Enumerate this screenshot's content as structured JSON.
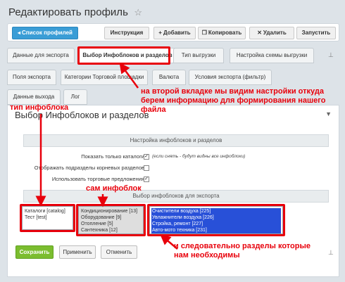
{
  "page_title": "Редактировать профиль",
  "toolbar": {
    "profile_list": "Список профилей",
    "instruction": "Инструкция",
    "add": "Добавить",
    "copy": "Копировать",
    "delete": "Удалить",
    "run": "Запустить"
  },
  "tabs_row1": [
    "Данные для экспорта",
    "Выбор Инфоблоков и разделов",
    "Тип выгрузки",
    "Настройка схемы выгрузки"
  ],
  "tabs_row2": [
    "Поля экспорта",
    "Категории Торговой площадки",
    "Валюта",
    "Условия экспорта (фильтр)"
  ],
  "tabs_row3": [
    "Данные выхода",
    "Лог"
  ],
  "panel": {
    "title": "Выбор Инфоблоков и разделов",
    "section1_title": "Настройка инфоблоков и разделов",
    "opt_show_catalogs": "Показать только каталоги",
    "opt_show_catalogs_note": "(если снять - будут видны все инфоблоки)",
    "opt_show_subsections": "Отображать подразделы корневых разделов",
    "opt_use_offers": "Использовать торговые предложения",
    "section2_title": "Выбор инфоблоков для экспорта"
  },
  "iblock_types": [
    "Каталоги [catalog]",
    "Тест [test]"
  ],
  "iblocks": [
    "Кондиционирование [13]",
    "Оборудование [9]",
    "Отопление [5]",
    "Сантехника [12]"
  ],
  "sections": [
    "Очистители воздуха [225]",
    "Увлажнители воздуха [226]",
    "Стройка, ремонт [227]",
    "Авто-мото техника [231]"
  ],
  "buttons": {
    "save": "Сохранить",
    "apply": "Применить",
    "cancel": "Отменить"
  },
  "annotations": {
    "second_tab": "на второй вкладке мы видим настройки откуда берем информацию для формирования нашего файла",
    "iblock_type": "тип инфоблока",
    "iblock": "сам инфоблок",
    "sections": "и следовательно разделы которые нам необходимы"
  },
  "colors": {
    "annotation": "#e8000b",
    "selection": "#2850d8",
    "primary_button": "#3a9dd6",
    "save_button": "#7bbd2f"
  }
}
